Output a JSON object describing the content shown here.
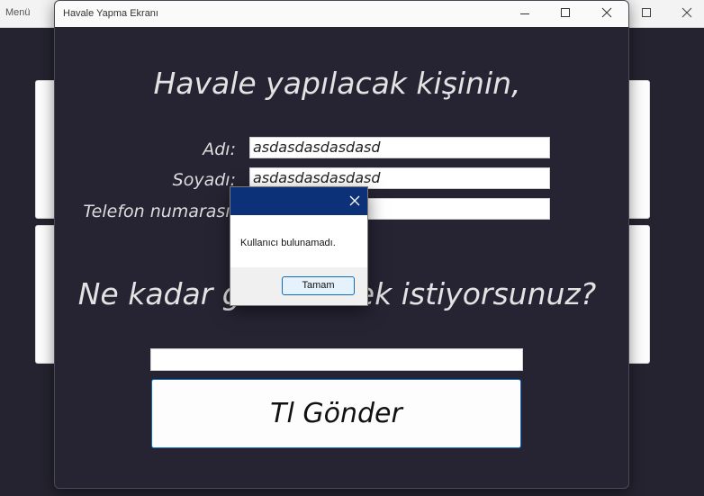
{
  "background_window": {
    "title": "Menü"
  },
  "window": {
    "title": "Havale Yapma Ekranı",
    "heading": "Havale yapılacak kişinin,",
    "amount_heading": "Ne kadar göndermek istiyorsunuz?",
    "fields": {
      "first_name_label": "Adı:",
      "first_name_value": "asdasdasdasdasd",
      "last_name_label": "Soyadı:",
      "last_name_value": "asdasdasdasdasd",
      "phone_label": "Telefon numarası:",
      "phone_value": "",
      "amount_value": ""
    },
    "send_button_label": "Tl Gönder"
  },
  "dialog": {
    "message": "Kullanıcı bulunamadı.",
    "ok_label": "Tamam",
    "accent_color": "#0c3178"
  },
  "icons": [
    "minimize-icon",
    "maximize-icon",
    "close-icon"
  ]
}
